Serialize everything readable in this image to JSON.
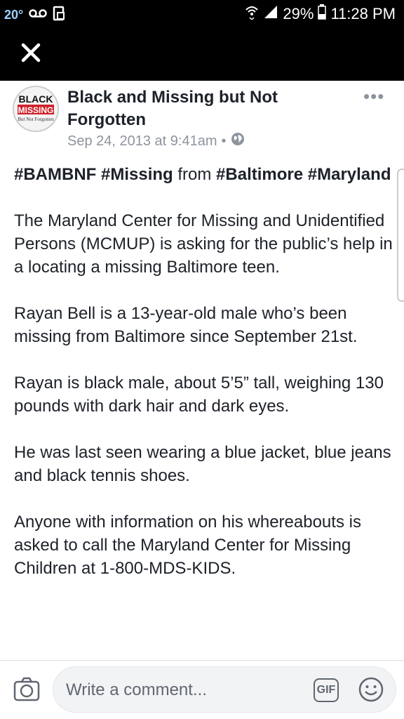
{
  "status_bar": {
    "temperature": "20°",
    "battery": "29%",
    "time": "11:28 PM"
  },
  "post": {
    "author": "Black and Missing but Not Forgotten",
    "avatar_text": {
      "line1": "BLACK",
      "line2": "MISSING",
      "line3": "But Not Forgotten"
    },
    "timestamp": "Sep 24, 2013 at 9:41am",
    "separator": "•",
    "tags": {
      "t1": "#BAMBNF",
      "t2": "#Missing",
      "from": "from",
      "t3": "#Baltimore",
      "t4": "#Maryland"
    },
    "paragraphs": [
      "The Maryland Center for Missing and Unidentified Persons (MCMUP) is asking for the public’s help in a locating a missing Baltimore teen.",
      "Rayan Bell is a 13-year-old male who’s been missing from Baltimore since September 21st.",
      "Rayan is black male, about 5’5” tall, weighing 130 pounds with dark hair and dark eyes.",
      "He was last seen wearing a blue jacket, blue jeans and black tennis shoes.",
      "Anyone with information on his whereabouts is asked to call the Maryland Center for Missing Children at 1-800-MDS-KIDS."
    ]
  },
  "comment_bar": {
    "placeholder": "Write a comment...",
    "gif_label": "GIF"
  },
  "colors": {
    "top_bar": "#000000",
    "text": "#1d2129",
    "meta": "#8d949e",
    "avatar_red": "#d0202a"
  }
}
